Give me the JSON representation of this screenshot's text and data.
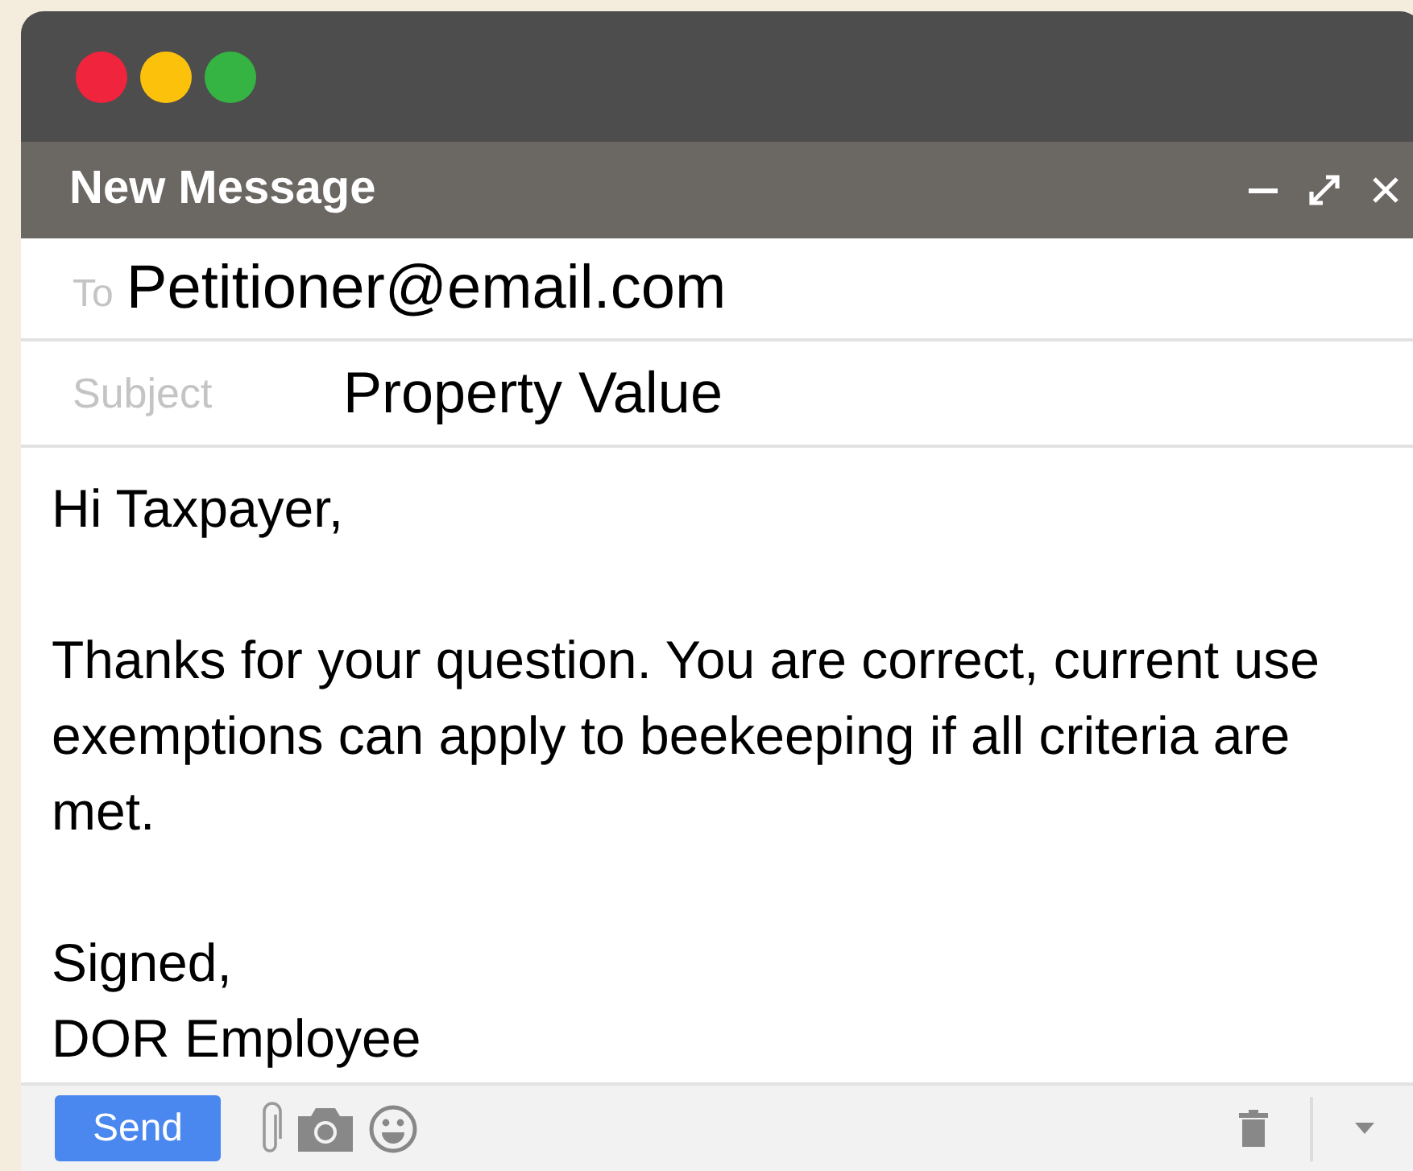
{
  "window": {
    "title": "New Message"
  },
  "to": {
    "label": "To",
    "value": "Petitioner@email.com"
  },
  "subject": {
    "label": "Subject",
    "value": "Property Value"
  },
  "body": [
    {
      "lines": [
        "Hi Taxpayer,"
      ]
    },
    {
      "lines": [
        "Thanks for your question. You are correct, current use exemptions can apply to beekeeping if all criteria are met."
      ]
    },
    {
      "lines": [
        "Signed,",
        "DOR Employee"
      ]
    }
  ],
  "footer": {
    "send": "Send"
  }
}
